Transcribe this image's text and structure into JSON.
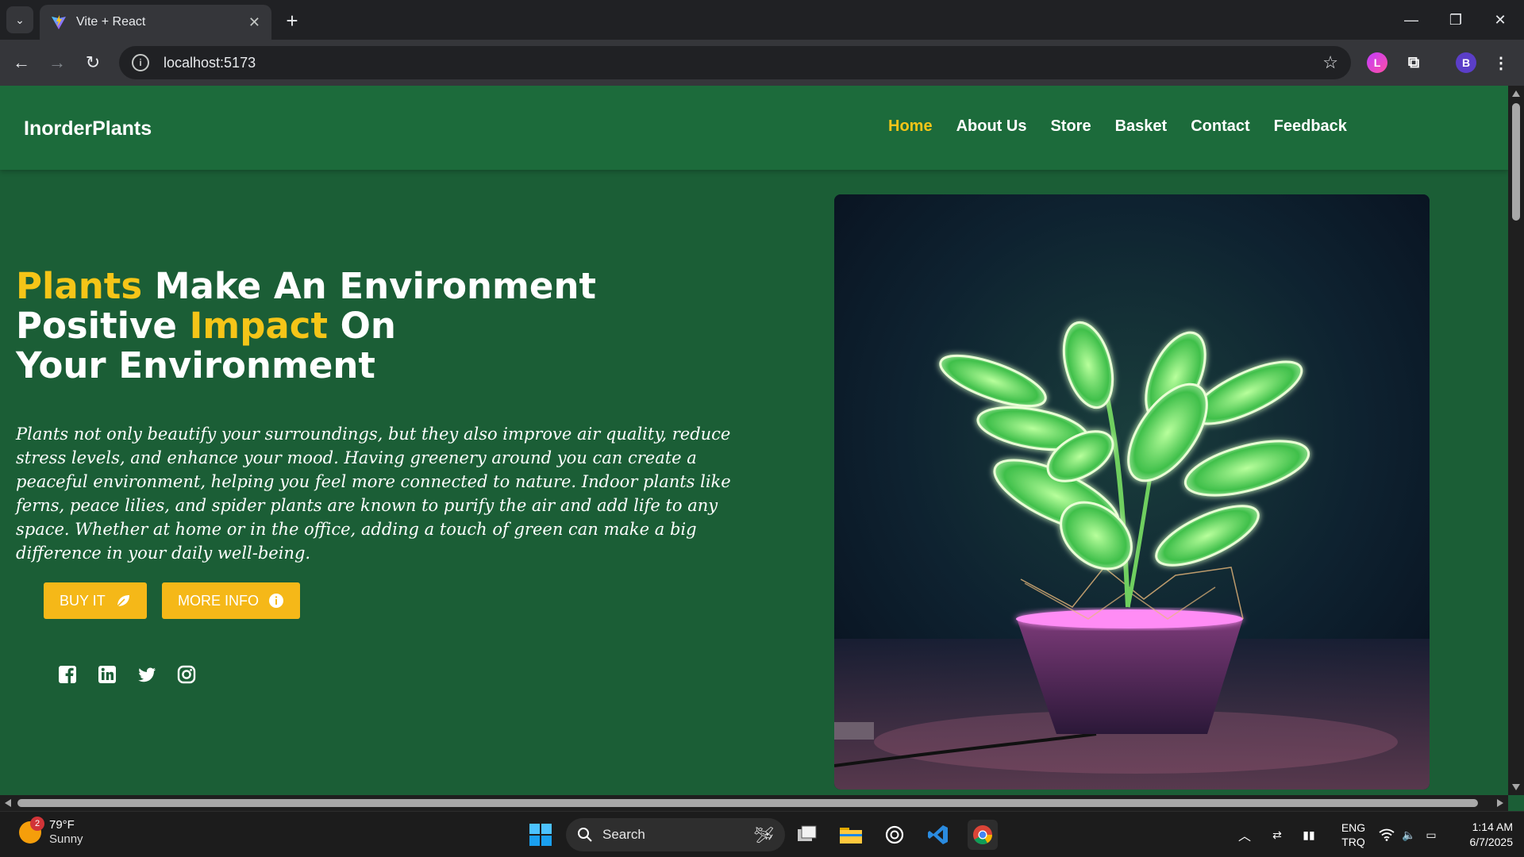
{
  "browser": {
    "tab_title": "Vite + React",
    "url": "localhost:5173",
    "profile_initial": "B"
  },
  "site": {
    "logo": "InorderPlants",
    "nav": [
      {
        "label": "Home",
        "active": true
      },
      {
        "label": "About Us",
        "active": false
      },
      {
        "label": "Store",
        "active": false
      },
      {
        "label": "Basket",
        "active": false
      },
      {
        "label": "Contact",
        "active": false
      },
      {
        "label": "Feedback",
        "active": false
      }
    ],
    "hero": {
      "line1_hl": "Plants",
      "line1_rest": " Make An Environment",
      "line2_start": "Positive ",
      "line2_hl": "Impact",
      "line2_rest": " On",
      "line3": "Your Environment",
      "description": "Plants not only beautify your surroundings, but they also improve air quality, reduce stress levels, and enhance your mood. Having greenery around you can create a peaceful environment, helping you feel more connected to nature. Indoor plants like ferns, peace lilies, and spider plants are known to purify the air and add life to any space. Whether at home or in the office, adding a touch of green can make a big difference in your daily well-being.",
      "buy_button": "BUY IT",
      "info_button": "MORE INFO"
    },
    "social": [
      "facebook-icon",
      "linkedin-icon",
      "twitter-icon",
      "instagram-icon"
    ],
    "colors": {
      "header": "#1c6b3b",
      "background": "#1b5e36",
      "accent": "#f5c518",
      "button": "#f5b818"
    }
  },
  "taskbar": {
    "weather_temp": "79°F",
    "weather_desc": "Sunny",
    "weather_badge": "2",
    "search_label": "Search",
    "lang1": "ENG",
    "lang2": "TRQ",
    "time": "1:14 AM",
    "date": "6/7/2025"
  }
}
